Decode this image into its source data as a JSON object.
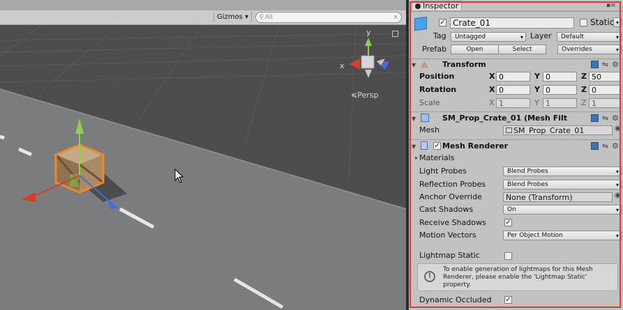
{
  "scene": {
    "gizmos_label": "Gizmos",
    "search_placeholder": "All",
    "persp_label": "Persp",
    "axis_x": "x",
    "axis_y": "y"
  },
  "inspector": {
    "tab_title": "Inspector",
    "object": {
      "name": "Crate_01",
      "static_label": "Static",
      "tag_label": "Tag",
      "tag_value": "Untagged",
      "layer_label": "Layer",
      "layer_value": "Default",
      "prefab_label": "Prefab",
      "open_button": "Open",
      "select_button": "Select",
      "overrides": "Overrides"
    },
    "transform": {
      "title": "Transform",
      "position_label": "Position",
      "rotation_label": "Rotation",
      "scale_label": "Scale",
      "position": {
        "x": "0",
        "y": "0",
        "z": "50"
      },
      "rotation": {
        "x": "0",
        "y": "0",
        "z": "0"
      },
      "scale": {
        "x": "1",
        "y": "1",
        "z": "1"
      },
      "x_axis": "X",
      "y_axis": "Y",
      "z_axis": "Z"
    },
    "mesh_filter": {
      "title": "SM_Prop_Crate_01 (Mesh Filt",
      "mesh_label": "Mesh",
      "mesh_value": "SM_Prop_Crate_01"
    },
    "mesh_renderer": {
      "title": "Mesh Renderer",
      "materials_label": "Materials",
      "light_probes_label": "Light Probes",
      "light_probes_value": "Blend Probes",
      "reflection_probes_label": "Reflection Probes",
      "reflection_probes_value": "Blend Probes",
      "anchor_override_label": "Anchor Override",
      "anchor_override_value": "None (Transform)",
      "cast_shadows_label": "Cast Shadows",
      "cast_shadows_value": "On",
      "receive_shadows_label": "Receive Shadows",
      "motion_vectors_label": "Motion Vectors",
      "motion_vectors_value": "Per Object Motion",
      "lightmap_static_label": "Lightmap Static",
      "help_text": "To enable generation of lightmaps for this Mesh Renderer, please enable the 'Lightmap Static' property.",
      "dynamic_occluded_label": "Dynamic Occluded"
    }
  },
  "colors": {
    "highlight_border": "#e0392b",
    "selection_outline": "#f08a24",
    "gizmo_x": "#d2402a",
    "gizmo_y": "#8fd14a",
    "gizmo_z": "#3d6fe0"
  }
}
